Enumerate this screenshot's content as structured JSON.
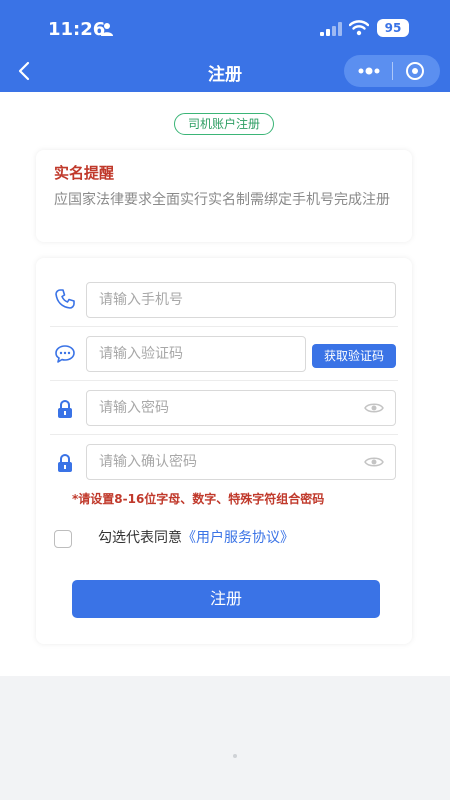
{
  "status_bar": {
    "time": "11:26",
    "battery": "95"
  },
  "nav": {
    "title": "注册"
  },
  "tag": "司机账户注册",
  "notice": {
    "title": "实名提醒",
    "text": "应国家法律要求全面实行实名制需绑定手机号完成注册"
  },
  "form": {
    "phone_placeholder": "请输入手机号",
    "code_placeholder": "请输入验证码",
    "get_code_label": "获取验证码",
    "password_placeholder": "请输入密码",
    "confirm_placeholder": "请输入确认密码",
    "password_hint": "*请设置8-16位字母、数字、特殊字符组合密码",
    "agree_prefix": "勾选代表同意",
    "agree_link": "《用户服务协议》",
    "submit_label": "注册"
  },
  "colors": {
    "primary": "#3a73e6",
    "tag_green": "#3bb577",
    "alert_red": "#c0392b"
  },
  "icons": [
    "person-icon",
    "signal-icon",
    "wifi-icon",
    "back-icon",
    "more-icon",
    "target-icon",
    "phone-icon",
    "chat-icon",
    "lock-icon",
    "eye-icon"
  ]
}
